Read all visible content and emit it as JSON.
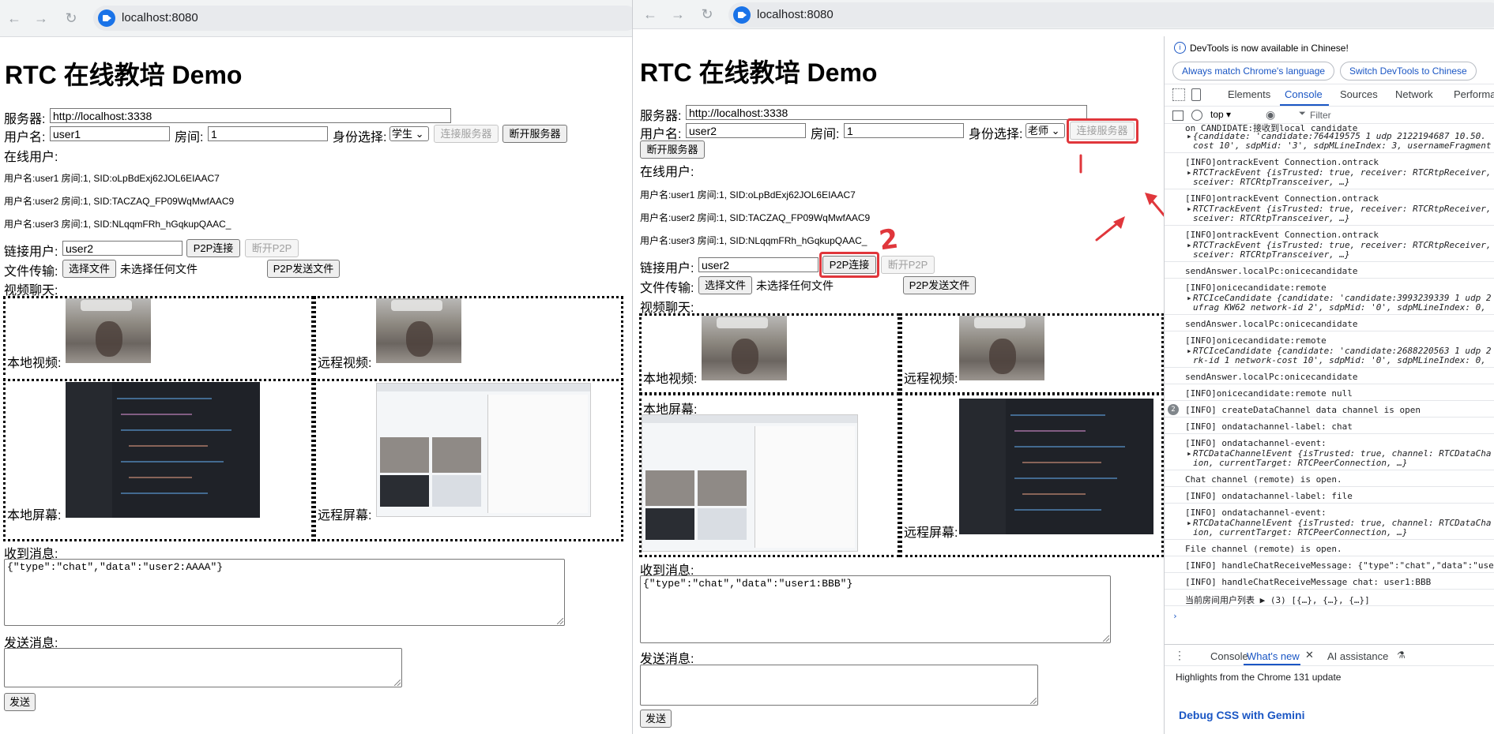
{
  "left_window": {
    "url": "localhost:8080",
    "heading": "RTC 在线教培 Demo",
    "server_label": "服务器:",
    "server_value": "http://localhost:3338",
    "username_label": "用户名:",
    "username_value": "user1",
    "room_label": "房间:",
    "room_value": "1",
    "role_label": "身份选择:",
    "role_value": "学生",
    "connect_server": "连接服务器",
    "disconnect_server": "断开服务器",
    "online_users_label": "在线用户:",
    "online_users": [
      "用户名:user1 房间:1, SID:oLpBdExj62JOL6EIAAC7",
      "用户名:user2 房间:1, SID:TACZAQ_FP09WqMwfAAC9",
      "用户名:user3 房间:1, SID:NLqqmFRh_hGqkupQAAC_"
    ],
    "link_user_label": "链接用户:",
    "link_user_value": "user2",
    "p2p_connect": "P2P连接",
    "p2p_disconnect": "断开P2P",
    "file_transfer_label": "文件传输:",
    "choose_file": "选择文件",
    "no_file": "未选择任何文件",
    "p2p_send_file": "P2P发送文件",
    "video_chat_label": "视频聊天:",
    "local_video": "本地视频:",
    "remote_video": "远程视频:",
    "local_screen": "本地屏幕:",
    "remote_screen": "远程屏幕:",
    "received_label": "收到消息:",
    "received_text": "{\"type\":\"chat\",\"data\":\"user2:AAAA\"}",
    "send_label": "发送消息:",
    "send_button": "发送"
  },
  "right_window": {
    "url": "localhost:8080",
    "heading": "RTC 在线教培 Demo",
    "server_label": "服务器:",
    "server_value": "http://localhost:3338",
    "username_label": "用户名:",
    "username_value": "user2",
    "room_label": "房间:",
    "room_value": "1",
    "role_label": "身份选择:",
    "role_value": "老师",
    "connect_server": "连接服务器",
    "disconnect_server": "断开服务器",
    "online_users_label": "在线用户:",
    "online_users": [
      "用户名:user1 房间:1, SID:oLpBdExj62JOL6EIAAC7",
      "用户名:user2 房间:1, SID:TACZAQ_FP09WqMwfAAC9",
      "用户名:user3 房间:1, SID:NLqqmFRh_hGqkupQAAC_"
    ],
    "link_user_label": "链接用户:",
    "link_user_value": "user2",
    "p2p_connect": "P2P连接",
    "p2p_disconnect": "断开P2P",
    "file_transfer_label": "文件传输:",
    "choose_file": "选择文件",
    "no_file": "未选择任何文件",
    "p2p_send_file": "P2P发送文件",
    "video_chat_label": "视频聊天:",
    "local_video": "本地视频:",
    "remote_video": "远程视频:",
    "local_screen": "本地屏幕:",
    "remote_screen": "远程屏幕:",
    "received_label": "收到消息:",
    "received_text": "{\"type\":\"chat\",\"data\":\"user1:BBB\"}",
    "send_label": "发送消息:",
    "send_button": "发送",
    "annotation_number": "2"
  },
  "devtools": {
    "banner": "DevTools is now available in Chinese!",
    "pill_1": "Always match Chrome's language",
    "pill_2": "Switch DevTools to Chinese",
    "tabs": [
      "Elements",
      "Console",
      "Sources",
      "Network",
      "Performa"
    ],
    "context": "top",
    "filter_placeholder": "Filter",
    "bottom_tabs": [
      "Console",
      "What's new",
      "AI assistance"
    ],
    "highlights": "Highlights from the Chrome 131 update",
    "debug_css": "Debug CSS with Gemini",
    "repeat_count": "2",
    "console_lines": [
      "on CANDIDATE:接收到local candidate",
      "{candidate: 'candidate:764419575 1 udp 2122194687 10.50.",
      "cost 10', sdpMid: '3', sdpMLineIndex: 3, usernameFragment",
      "[INFO]ontrackEvent Connection.ontrack",
      "RTCTrackEvent {isTrusted: true, receiver: RTCRtpReceiver,",
      "sceiver: RTCRtpTransceiver, …}",
      "[INFO]ontrackEvent Connection.ontrack",
      "RTCTrackEvent {isTrusted: true, receiver: RTCRtpReceiver,",
      "sceiver: RTCRtpTransceiver, …}",
      "[INFO]ontrackEvent Connection.ontrack",
      "RTCTrackEvent {isTrusted: true, receiver: RTCRtpReceiver,",
      "sceiver: RTCRtpTransceiver, …}",
      "sendAnswer.localPc:onicecandidate",
      "[INFO]onicecandidate:remote",
      "RTCIceCandidate {candidate: 'candidate:3993239339 1 udp 2",
      "ufrag KW62 network-id 2', sdpMid: '0', sdpMLineIndex: 0,",
      "sendAnswer.localPc:onicecandidate",
      "[INFO]onicecandidate:remote",
      "RTCIceCandidate {candidate: 'candidate:2688220563 1 udp 2",
      "rk-id 1 network-cost 10', sdpMid: '0', sdpMLineIndex: 0,",
      "sendAnswer.localPc:onicecandidate",
      "[INFO]onicecandidate:remote null",
      "[INFO] createDataChannel data channel is open",
      "[INFO] ondatachannel-label: chat",
      "[INFO] ondatachannel-event:",
      "RTCDataChannelEvent {isTrusted: true, channel: RTCDataCha",
      "ion, currentTarget: RTCPeerConnection, …}",
      "Chat channel (remote) is open.",
      "[INFO] ondatachannel-label: file",
      "[INFO] ondatachannel-event:",
      "RTCDataChannelEvent {isTrusted: true, channel: RTCDataCha",
      "ion, currentTarget: RTCPeerConnection, …}",
      "File channel (remote) is open.",
      "[INFO] handleChatReceiveMessage: {\"type\":\"chat\",\"data\":\"use",
      "[INFO] handleChatReceiveMessage chat: user1:BBB",
      "当前房间用户列表  ▶ (3) [{…}, {…}, {…}]"
    ]
  },
  "colors": {
    "annotation_red": "#e0363b",
    "devtools_accent": "#1a56c4"
  }
}
